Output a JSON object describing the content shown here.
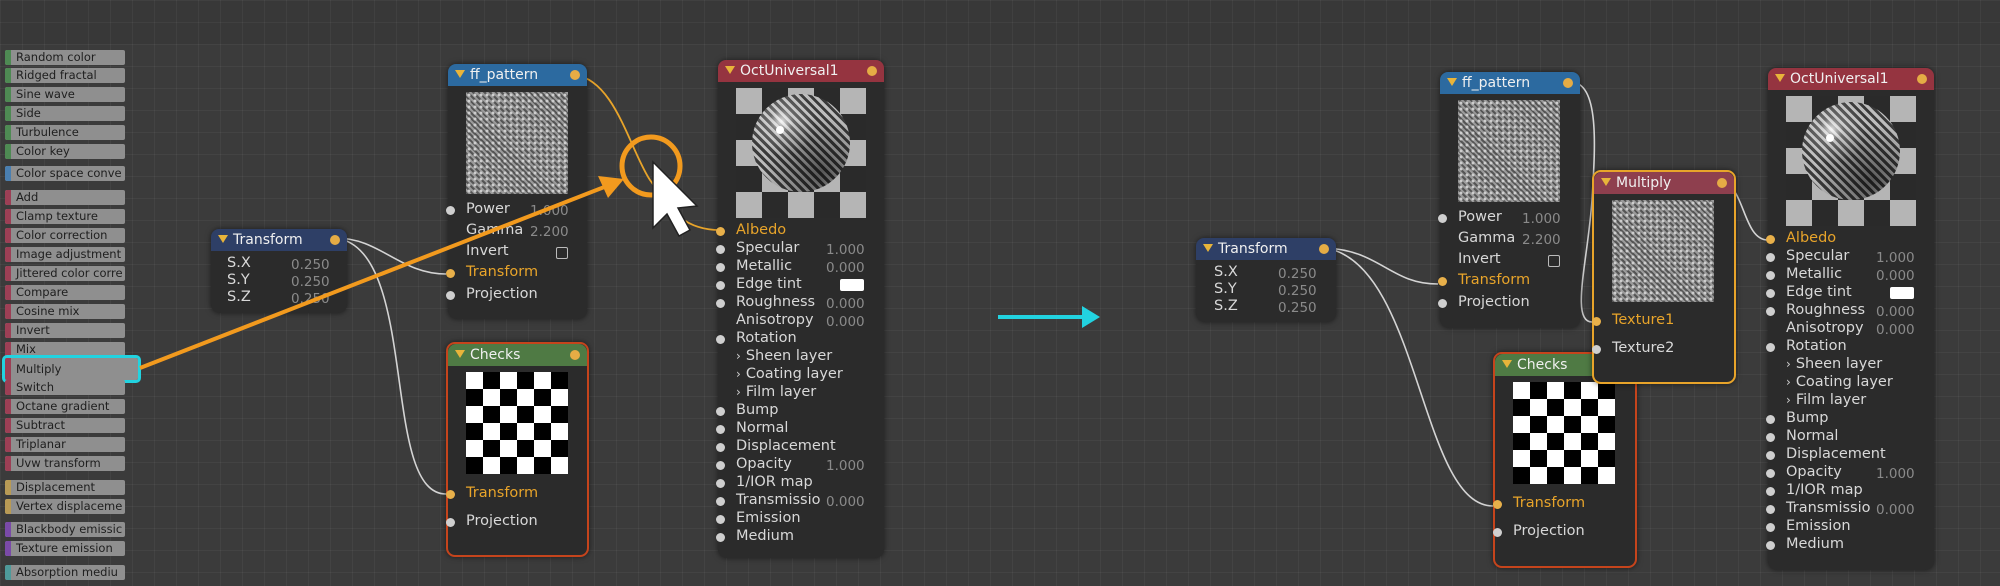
{
  "palette": [
    {
      "label": "Random color",
      "color": "#4e8a53"
    },
    {
      "label": "Ridged fractal",
      "color": "#4e8a53"
    },
    {
      "label": "Sine wave",
      "color": "#4e8a53"
    },
    {
      "label": "Side",
      "color": "#4e8a53"
    },
    {
      "label": "Turbulence",
      "color": "#4e8a53"
    },
    {
      "label": "Color key",
      "color": "#4e8a53"
    },
    {
      "label": "Color space conve",
      "color": "#4a7fb0"
    },
    {
      "label": "Add",
      "color": "#9c3f55"
    },
    {
      "label": "Clamp texture",
      "color": "#9c3f55"
    },
    {
      "label": "Color correction",
      "color": "#9c3f55"
    },
    {
      "label": "Image adjustment",
      "color": "#9c3f55"
    },
    {
      "label": "Jittered color corre",
      "color": "#9c3f55"
    },
    {
      "label": "Compare",
      "color": "#9c3f55"
    },
    {
      "label": "Cosine mix",
      "color": "#9c3f55"
    },
    {
      "label": "Invert",
      "color": "#9c3f55"
    },
    {
      "label": "Mix",
      "color": "#9c3f55"
    },
    {
      "label": "Multiply",
      "color": "#9c3f55"
    },
    {
      "label": "Switch",
      "color": "#9c3f55"
    },
    {
      "label": "Octane gradient",
      "color": "#9c3f55"
    },
    {
      "label": "Subtract",
      "color": "#9c3f55"
    },
    {
      "label": "Triplanar",
      "color": "#9c3f55"
    },
    {
      "label": "Uvw transform",
      "color": "#9c3f55"
    },
    {
      "label": "Displacement",
      "color": "#b89a55"
    },
    {
      "label": "Vertex displaceme",
      "color": "#b89a55"
    },
    {
      "label": "Blackbody emissic",
      "color": "#7a4aa8"
    },
    {
      "label": "Texture emission",
      "color": "#7a4aa8"
    },
    {
      "label": "Absorption mediu",
      "color": "#4e9a9a"
    }
  ],
  "colors": {
    "accent_orange": "#e8a42a",
    "arrow_orange": "#f29a1e",
    "highlight_cyan": "#22d3e0",
    "wire": "#d8d8d8"
  },
  "before": {
    "transform": {
      "title": "Transform",
      "rows": [
        {
          "label": "S.X",
          "value": "0.250"
        },
        {
          "label": "S.Y",
          "value": "0.250"
        },
        {
          "label": "S.Z",
          "value": "0.250"
        }
      ]
    },
    "ff_pattern": {
      "title": "ff_pattern",
      "power_label": "Power",
      "power_value": "1.000",
      "gamma_label": "Gamma",
      "gamma_value": "2.200",
      "invert_label": "Invert",
      "transform_label": "Transform",
      "projection_label": "Projection"
    },
    "checks": {
      "title": "Checks",
      "transform_label": "Transform",
      "projection_label": "Projection"
    },
    "universal": {
      "title": "OctUniversal1",
      "albedo": "Albedo",
      "specular": "Specular",
      "specular_value": "1.000",
      "metallic": "Metallic",
      "metallic_value": "0.000",
      "edge_tint": "Edge tint",
      "roughness": "Roughness",
      "roughness_value": "0.000",
      "anisotropy": "Anisotropy",
      "anisotropy_value": "0.000",
      "rotation": "Rotation",
      "sheen": "Sheen layer",
      "coating": "Coating layer",
      "film": "Film layer",
      "bump": "Bump",
      "normal": "Normal",
      "displacement": "Displacement",
      "opacity": "Opacity",
      "opacity_value": "1.000",
      "ior": "1/IOR map",
      "transmission": "Transmissio",
      "transmission_value": "0.000",
      "emission": "Emission",
      "medium": "Medium"
    }
  },
  "after": {
    "transform": {
      "title": "Transform",
      "rows": [
        {
          "label": "S.X",
          "value": "0.250"
        },
        {
          "label": "S.Y",
          "value": "0.250"
        },
        {
          "label": "S.Z",
          "value": "0.250"
        }
      ]
    },
    "ff_pattern": {
      "title": "ff_pattern",
      "power_label": "Power",
      "power_value": "1.000",
      "gamma_label": "Gamma",
      "gamma_value": "2.200",
      "invert_label": "Invert",
      "transform_label": "Transform",
      "projection_label": "Projection"
    },
    "checks": {
      "title": "Checks",
      "transform_label": "Transform",
      "projection_label": "Projection"
    },
    "multiply": {
      "title": "Multiply",
      "texture1": "Texture1",
      "texture2": "Texture2"
    },
    "universal": {
      "title": "OctUniversal1",
      "albedo": "Albedo",
      "specular": "Specular",
      "specular_value": "1.000",
      "metallic": "Metallic",
      "metallic_value": "0.000",
      "edge_tint": "Edge tint",
      "roughness": "Roughness",
      "roughness_value": "0.000",
      "anisotropy": "Anisotropy",
      "anisotropy_value": "0.000",
      "rotation": "Rotation",
      "sheen": "Sheen layer",
      "coating": "Coating layer",
      "film": "Film layer",
      "bump": "Bump",
      "normal": "Normal",
      "displacement": "Displacement",
      "opacity": "Opacity",
      "opacity_value": "1.000",
      "ior": "1/IOR map",
      "transmission": "Transmissio",
      "transmission_value": "0.000",
      "emission": "Emission",
      "medium": "Medium"
    }
  }
}
